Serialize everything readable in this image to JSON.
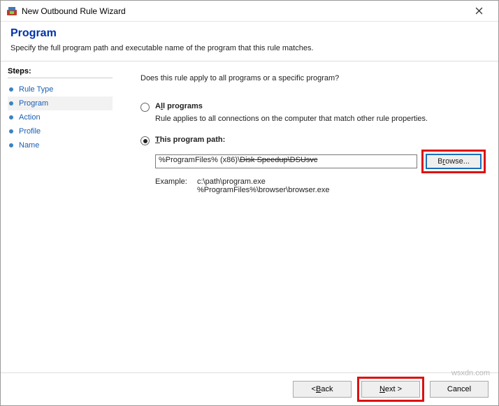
{
  "window": {
    "title": "New Outbound Rule Wizard"
  },
  "header": {
    "title": "Program",
    "subtitle": "Specify the full program path and executable name of the program that this rule matches."
  },
  "sidebar": {
    "heading": "Steps:",
    "items": [
      {
        "label": "Rule Type"
      },
      {
        "label": "Program"
      },
      {
        "label": "Action"
      },
      {
        "label": "Profile"
      },
      {
        "label": "Name"
      }
    ]
  },
  "main": {
    "question": "Does this rule apply to all programs or a specific program?",
    "option_all": {
      "label_pre": "A",
      "label_ul": "l",
      "label_post": "l programs",
      "desc": "Rule applies to all connections on the computer that match other rule properties."
    },
    "option_path": {
      "label_ul": "T",
      "label_post": "his program path:",
      "value_plain": "%ProgramFiles% (x86)\\",
      "value_strike": "Disk Speedup\\DSUsvc",
      "browse_pre": "B",
      "browse_ul": "r",
      "browse_post": "owse...",
      "example_label": "Example:",
      "example_paths": "c:\\path\\program.exe\n%ProgramFiles%\\browser\\browser.exe"
    }
  },
  "footer": {
    "back_pre": "< ",
    "back_ul": "B",
    "back_post": "ack",
    "next_ul": "N",
    "next_post": "ext >",
    "cancel": "Cancel"
  },
  "watermark": "wsxdn.com"
}
